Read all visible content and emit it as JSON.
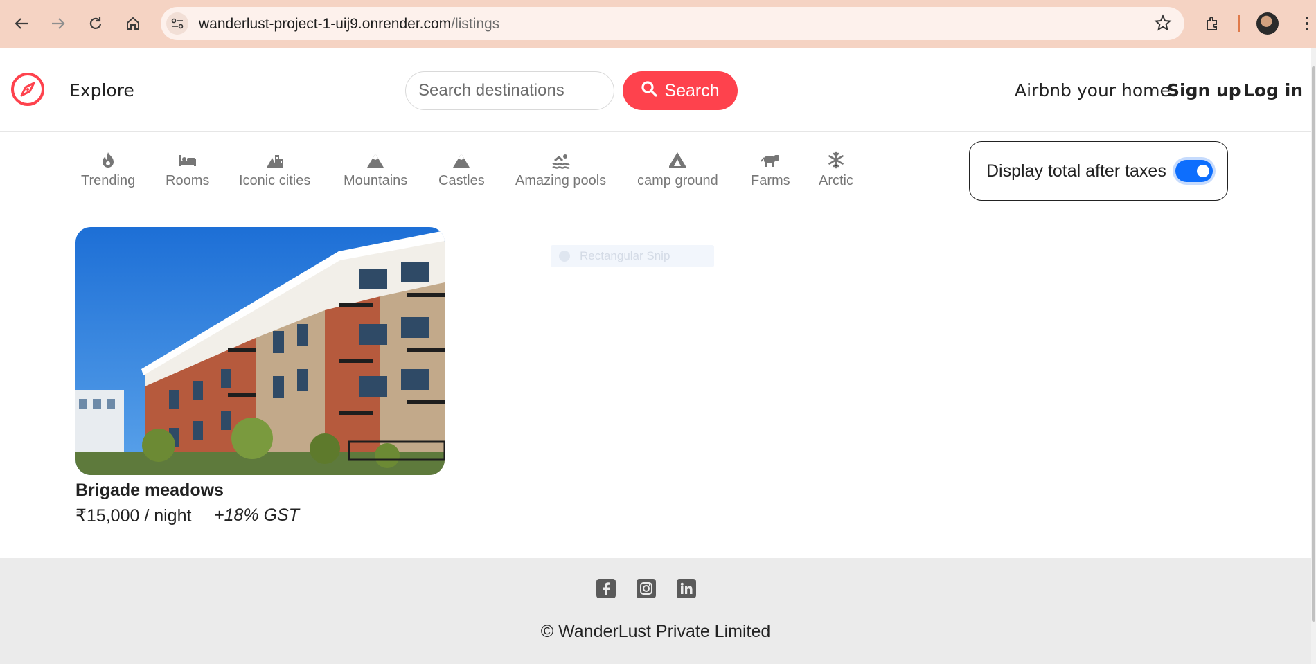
{
  "browser": {
    "url_host": "wanderlust-project-1-uij9.onrender.com",
    "url_path": "/listings",
    "icons": [
      "back-arrow-icon",
      "forward-arrow-icon",
      "reload-icon",
      "home-icon",
      "site-info-icon",
      "bookmark-star-icon",
      "extensions-icon",
      "profile-avatar"
    ]
  },
  "navbar": {
    "brand_icon": "compass-icon",
    "explore": "Explore",
    "search_placeholder": "Search destinations",
    "search_button": "Search",
    "airbnb_home": "Airbnb your home",
    "sign_up": "Sign up",
    "log_in": "Log in",
    "accent_color": "#fe424d"
  },
  "filters": [
    {
      "label": "Trending",
      "icon": "fire-icon"
    },
    {
      "label": "Rooms",
      "icon": "bed-icon"
    },
    {
      "label": "Iconic cities",
      "icon": "city-icon"
    },
    {
      "label": "Mountains",
      "icon": "mountain-icon"
    },
    {
      "label": "Castles",
      "icon": "castle-icon"
    },
    {
      "label": "Amazing pools",
      "icon": "swimmer-icon"
    },
    {
      "label": "camp ground",
      "icon": "tent-icon"
    },
    {
      "label": "Farms",
      "icon": "cow-icon"
    },
    {
      "label": "Arctic",
      "icon": "snowflake-icon"
    }
  ],
  "tax_toggle": {
    "label": "Display total after taxes",
    "enabled": true
  },
  "overlay_hint": "Rectangular Snip",
  "listing": {
    "title": "Brigade meadows",
    "price": "₹15,000 / night",
    "gst": "+18% GST"
  },
  "footer": {
    "social": [
      "facebook-icon",
      "instagram-icon",
      "linkedin-icon"
    ],
    "copyright": "© WanderLust Private Limited"
  }
}
